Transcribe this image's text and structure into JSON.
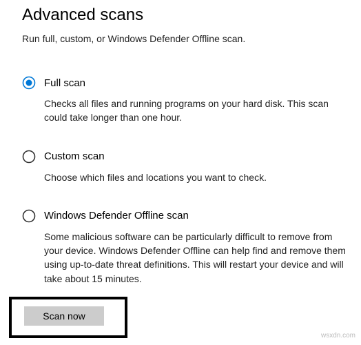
{
  "title": "Advanced scans",
  "subtitle": "Run full, custom, or Windows Defender Offline scan.",
  "accent_color": "#0078d7",
  "options": [
    {
      "id": "full",
      "label": "Full scan",
      "description": "Checks all files and running programs on your hard disk. This scan could take longer than one hour.",
      "selected": true
    },
    {
      "id": "custom",
      "label": "Custom scan",
      "description": "Choose which files and locations you want to check.",
      "selected": false
    },
    {
      "id": "offline",
      "label": "Windows Defender Offline scan",
      "description": "Some malicious software can be particularly difficult to remove from your device. Windows Defender Offline can help find and remove them using up-to-date threat definitions. This will restart your device and will take about 15 minutes.",
      "selected": false
    }
  ],
  "scan_button": "Scan now",
  "watermark": "wsxdn.com"
}
